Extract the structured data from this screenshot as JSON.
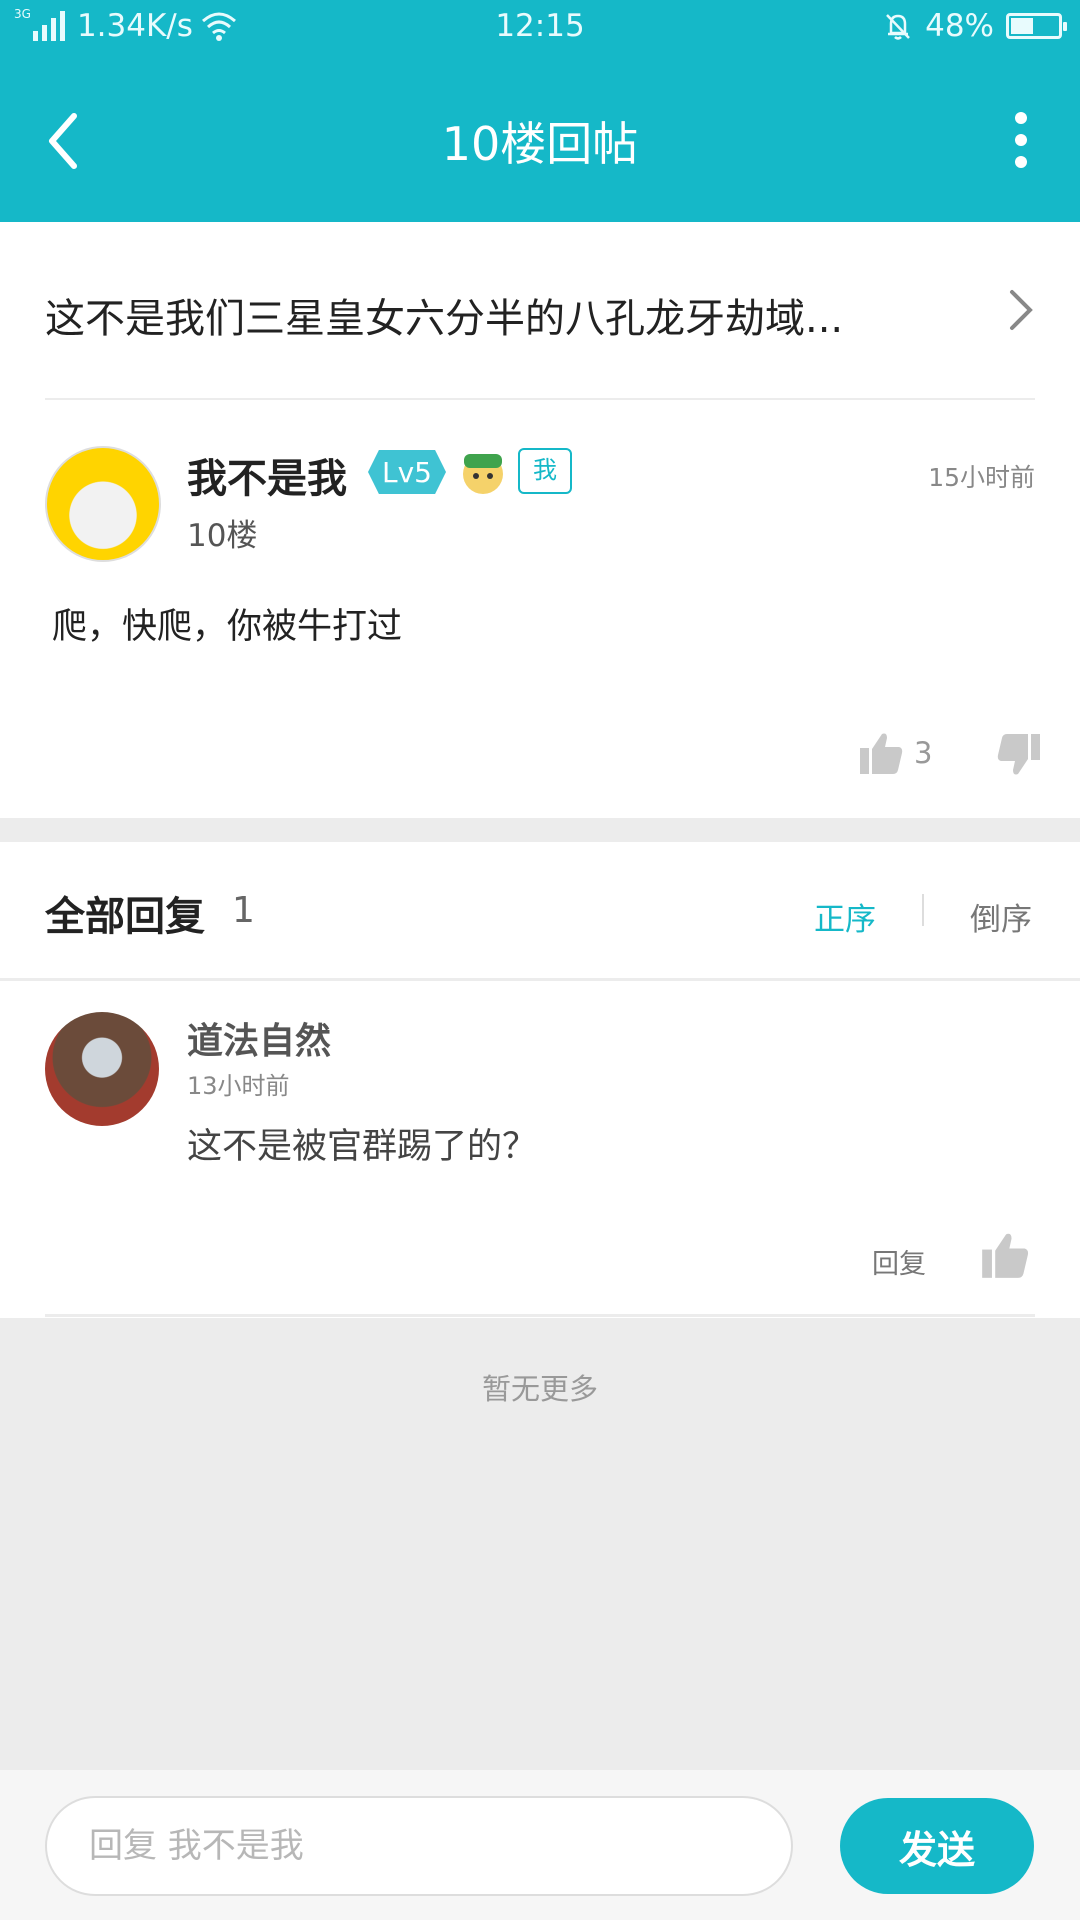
{
  "status_bar": {
    "network_type": "3G",
    "speed": "1.34K/s",
    "time": "12:15",
    "battery": "48%",
    "battery_level": 0.48
  },
  "app_bar": {
    "title": "10楼回帖",
    "back_icon": "back-arrow-icon",
    "more_icon": "more-vert-icon"
  },
  "thread": {
    "title": "这不是我们三星皇女六分半的八孔龙牙劫域..."
  },
  "post": {
    "author": "我不是我",
    "level": "Lv5",
    "me_tag": "我",
    "time": "15小时前",
    "floor": "10楼",
    "content": "爬，快爬，你被牛打过",
    "likes": "3"
  },
  "replies": {
    "heading": "全部回复",
    "count": "1",
    "sort_asc": "正序",
    "sort_desc": "倒序",
    "items": [
      {
        "author": "道法自然",
        "time": "13小时前",
        "text": "这不是被官群踢了的？",
        "reply_label": "回复"
      }
    ]
  },
  "footer": {
    "no_more": "暂无更多"
  },
  "composer": {
    "placeholder": "回复 我不是我",
    "send_label": "发送"
  },
  "colors": {
    "accent": "#15b8c8",
    "background": "#ececec"
  }
}
